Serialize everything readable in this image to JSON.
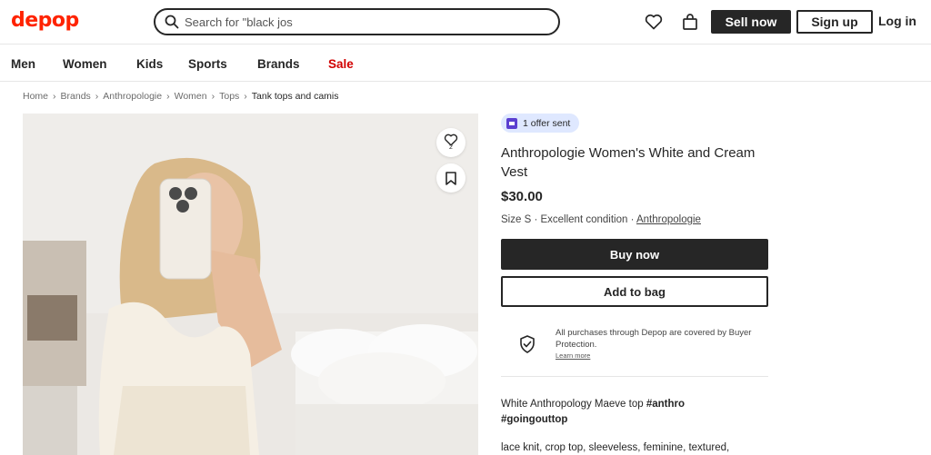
{
  "header": {
    "logo": "depop",
    "search_value": "Search for \"black jos",
    "sell_label": "Sell now",
    "signup_label": "Sign up",
    "login_label": "Log in",
    "brand_color": "#ff2300"
  },
  "nav": {
    "items": [
      "Men",
      "Women",
      "Kids",
      "Sports",
      "Brands",
      "Sale"
    ]
  },
  "breadcrumb": {
    "items": [
      "Home",
      "Brands",
      "Anthropologie",
      "Women",
      "Tops"
    ],
    "current": "Tank tops and camis"
  },
  "photo": {
    "like_count": "2"
  },
  "product": {
    "offer_badge": "1 offer sent",
    "title": "Anthropologie Women's White and Cream Vest",
    "price": "$30.00",
    "size": "Size S",
    "condition": "Excellent condition",
    "brand": "Anthropologie",
    "buy_label": "Buy now",
    "bag_label": "Add to bag"
  },
  "protection": {
    "text": "All purchases through Depop are covered by Buyer Protection.",
    "learn_more": "Learn more"
  },
  "description": {
    "line1_plain": "White Anthropology Maeve top ",
    "tag1": "#anthro",
    "tag2": "#goingouttop",
    "line3": "lace knit, crop top, sleeveless, feminine, textured,"
  }
}
